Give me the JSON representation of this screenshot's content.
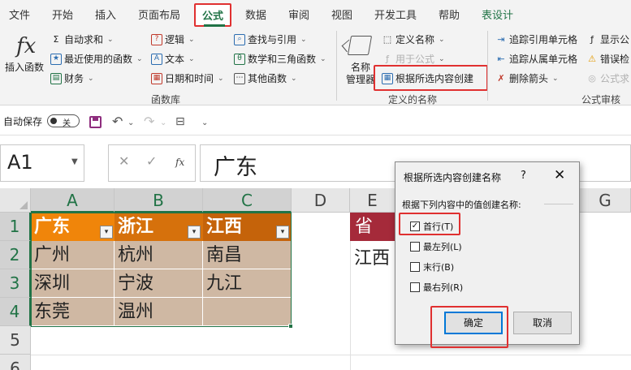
{
  "tabs": [
    "文件",
    "开始",
    "插入",
    "页面布局",
    "公式",
    "数据",
    "审阅",
    "视图",
    "开发工具",
    "帮助",
    "表设计"
  ],
  "active_tab": "公式",
  "ribbon": {
    "insert_function": "插入函数",
    "autosum": "自动求和",
    "recent": "最近使用的函数",
    "financial": "财务",
    "logical": "逻辑",
    "text": "文本",
    "datetime": "日期和时间",
    "lookup": "查找与引用",
    "math": "数学和三角函数",
    "other": "其他函数",
    "library_label": "函数库",
    "name_manager_1": "名称",
    "name_manager_2": "管理器",
    "define_name": "定义名称",
    "use_in_formula": "用于公式",
    "create_from_selection": "根据所选内容创建",
    "defined_names_label": "定义的名称",
    "trace_precedents": "追踪引用单元格",
    "trace_dependents": "追踪从属单元格",
    "remove_arrows": "删除箭头",
    "show_formulas": "显示公",
    "error_checking": "错误检",
    "evaluate_formula": "公式求",
    "audit_label": "公式审核"
  },
  "qat": {
    "autosave": "自动保存",
    "toggle": "关"
  },
  "formula_bar": {
    "name_box": "A1",
    "content": "广东"
  },
  "grid": {
    "columns": [
      "A",
      "B",
      "C",
      "D",
      "E",
      "G"
    ],
    "rows": [
      "1",
      "2",
      "3",
      "4",
      "5",
      "6"
    ],
    "table_header": [
      "广东",
      "浙江",
      "江西"
    ],
    "table_rows": [
      [
        "广州",
        "杭州",
        "南昌"
      ],
      [
        "深圳",
        "宁波",
        "九江"
      ],
      [
        "东莞",
        "温州",
        ""
      ]
    ],
    "header_colors": [
      "#f0850a",
      "#d6710c",
      "#c5630a"
    ],
    "e1": "省",
    "e2": "江西"
  },
  "dialog": {
    "title": "根据所选内容创建名称",
    "help": "?",
    "close": "✕",
    "prompt": "根据下列内容中的值创建名称:",
    "options": [
      {
        "label": "首行(T)",
        "checked": true
      },
      {
        "label": "最左列(L)",
        "checked": false
      },
      {
        "label": "末行(B)",
        "checked": false
      },
      {
        "label": "最右列(R)",
        "checked": false
      }
    ],
    "ok": "确定",
    "cancel": "取消"
  },
  "colors": {
    "accent": "#217346",
    "highlight": "#e03030",
    "ok_border": "#0078d7"
  }
}
